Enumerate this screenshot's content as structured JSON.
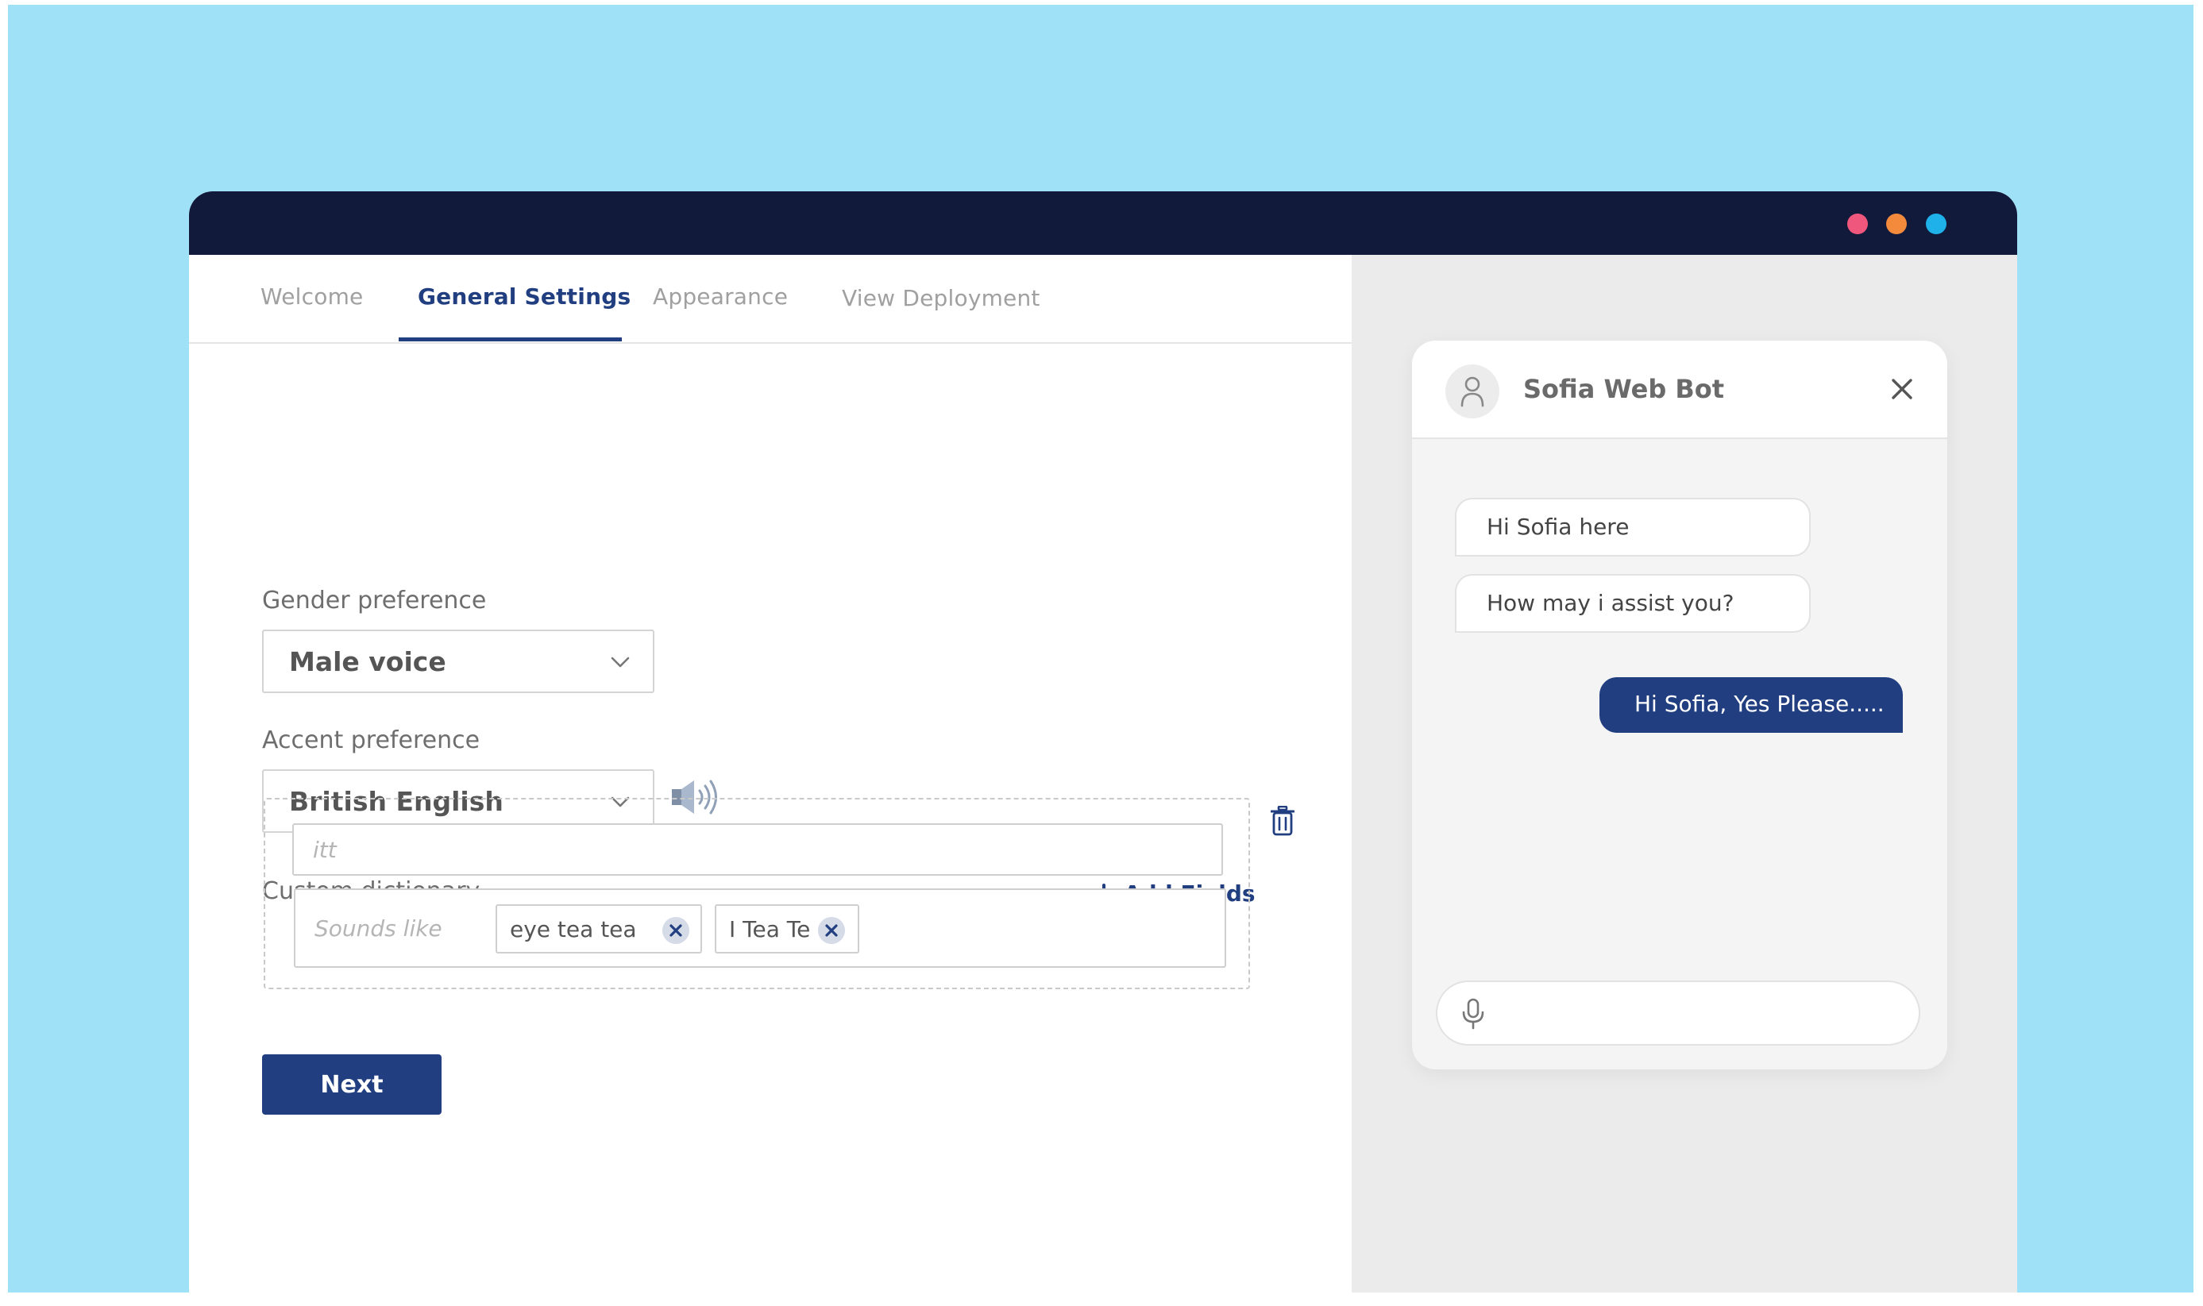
{
  "window": {
    "dots": [
      {
        "name": "close",
        "color": "#f0577c"
      },
      {
        "name": "minimize",
        "color": "#f48a3c"
      },
      {
        "name": "maximize",
        "color": "#1fb2ea"
      }
    ]
  },
  "tabs": [
    {
      "label": "Welcome",
      "active": false
    },
    {
      "label": "General Settings",
      "active": true
    },
    {
      "label": "Appearance",
      "active": false
    },
    {
      "label": "View Deployment",
      "active": false
    }
  ],
  "gender": {
    "label": "Gender preference",
    "value": "Male voice"
  },
  "accent": {
    "label": "Accent preference",
    "value": "British English"
  },
  "dictionary": {
    "label": "Custom dictionary",
    "add_label": "Add Fields",
    "word_placeholder": "itt",
    "sounds_like_placeholder": "Sounds like",
    "chips": [
      "eye tea tea",
      "I Tea Te"
    ]
  },
  "next_label": "Next",
  "chat": {
    "bot_name": "Sofia Web Bot",
    "bot_messages": [
      "Hi Sofia here",
      "How may i assist you?"
    ],
    "user_message": "Hi Sofia, Yes Please....."
  },
  "colors": {
    "primary": "#213f80",
    "titlebar": "#121a3c",
    "background": "#9fe2f8"
  }
}
